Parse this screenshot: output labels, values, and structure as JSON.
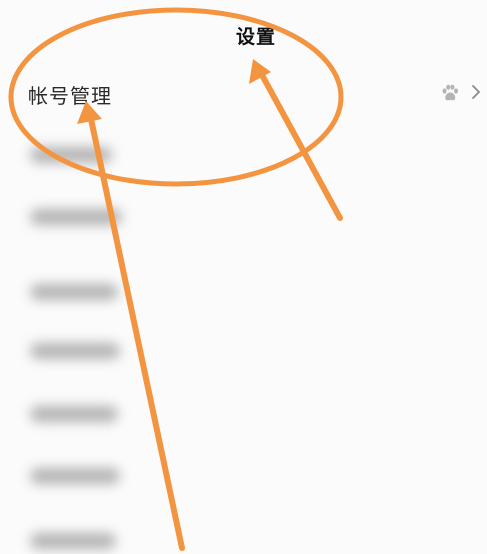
{
  "header": {
    "title": "设置"
  },
  "settings": {
    "items": [
      {
        "label": "帐号管理",
        "icon": "paw-icon",
        "trailing": "chevron-right-icon"
      }
    ]
  },
  "colors": {
    "annotation": "#f39440",
    "background": "#fbfbfb",
    "icon_gray": "#b4b4b4"
  }
}
